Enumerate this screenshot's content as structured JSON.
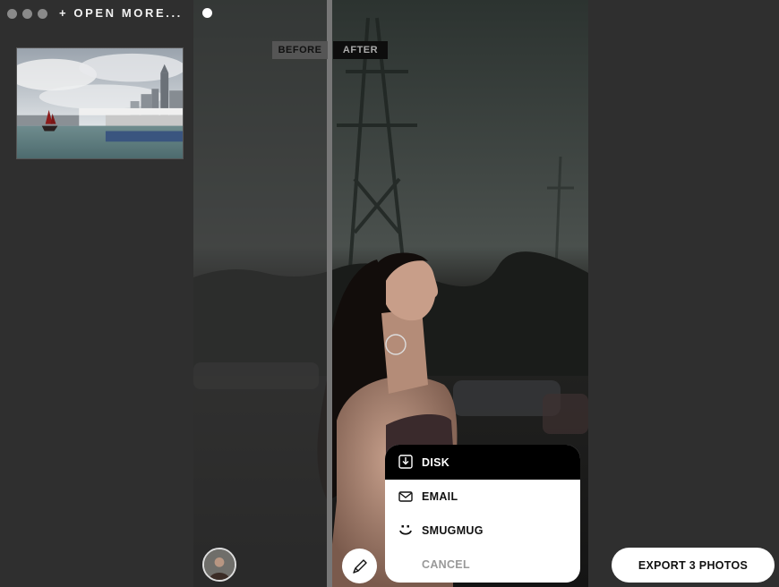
{
  "header": {
    "open_more_label": "+ OPEN MORE..."
  },
  "compare": {
    "before_label": "BEFORE",
    "after_label": "AFTER"
  },
  "export_menu": {
    "items": [
      {
        "label": "DISK",
        "icon": "download-icon"
      },
      {
        "label": "EMAIL",
        "icon": "mail-icon"
      },
      {
        "label": "SMUGMUG",
        "icon": "smugmug-icon"
      },
      {
        "label": "CANCEL"
      }
    ]
  },
  "export_button": {
    "label": "EXPORT 3 PHOTOS"
  },
  "colors": {
    "background": "#2f2f2f",
    "menu_selected": "#000000",
    "menu_bg": "#ffffff"
  }
}
